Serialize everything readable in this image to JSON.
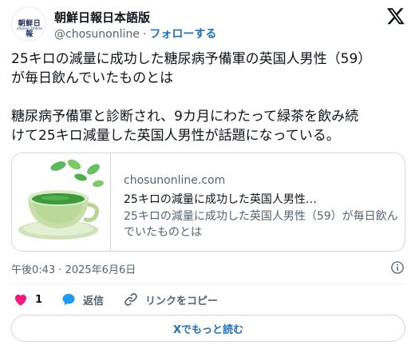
{
  "header": {
    "account_name": "朝鮮日報日本語版",
    "handle": "@chosunonline",
    "separator": "·",
    "follow_label": "フォローする",
    "avatar_logo_text": "朝鮮日報",
    "avatar_logo_sub": "chosun Online"
  },
  "tweet": {
    "lines": [
      "25キロの減量に成功した糖尿病予備軍の英国人男性（59）",
      "が毎日飲んでいたものとは",
      "糖尿病予備軍と診断され、9カ月にわたって緑茶を飲み続",
      "けて25キロ減量した英国人男性が話題になっている。"
    ]
  },
  "card": {
    "domain": "chosunonline.com",
    "title": "25キロの減量に成功した英国人男性…",
    "description": "25キロの減量に成功した英国人男性（59）が毎日飲んでいたものとは"
  },
  "meta": {
    "timestamp": "午後0:43 · 2025年6月6日"
  },
  "actions": {
    "like_count": "1",
    "reply_label": "返信",
    "copy_link_label": "リンクをコピー"
  },
  "read_more_label": "Xでもっと読む",
  "colors": {
    "like": "#f91880",
    "link": "#1d72b8",
    "reply": "#1d9bf0",
    "muted": "#536471"
  },
  "icons": {
    "x": "x-logo-icon",
    "info": "info-icon",
    "like": "heart-icon",
    "reply": "speech-bubble-icon",
    "copy": "link-icon"
  }
}
